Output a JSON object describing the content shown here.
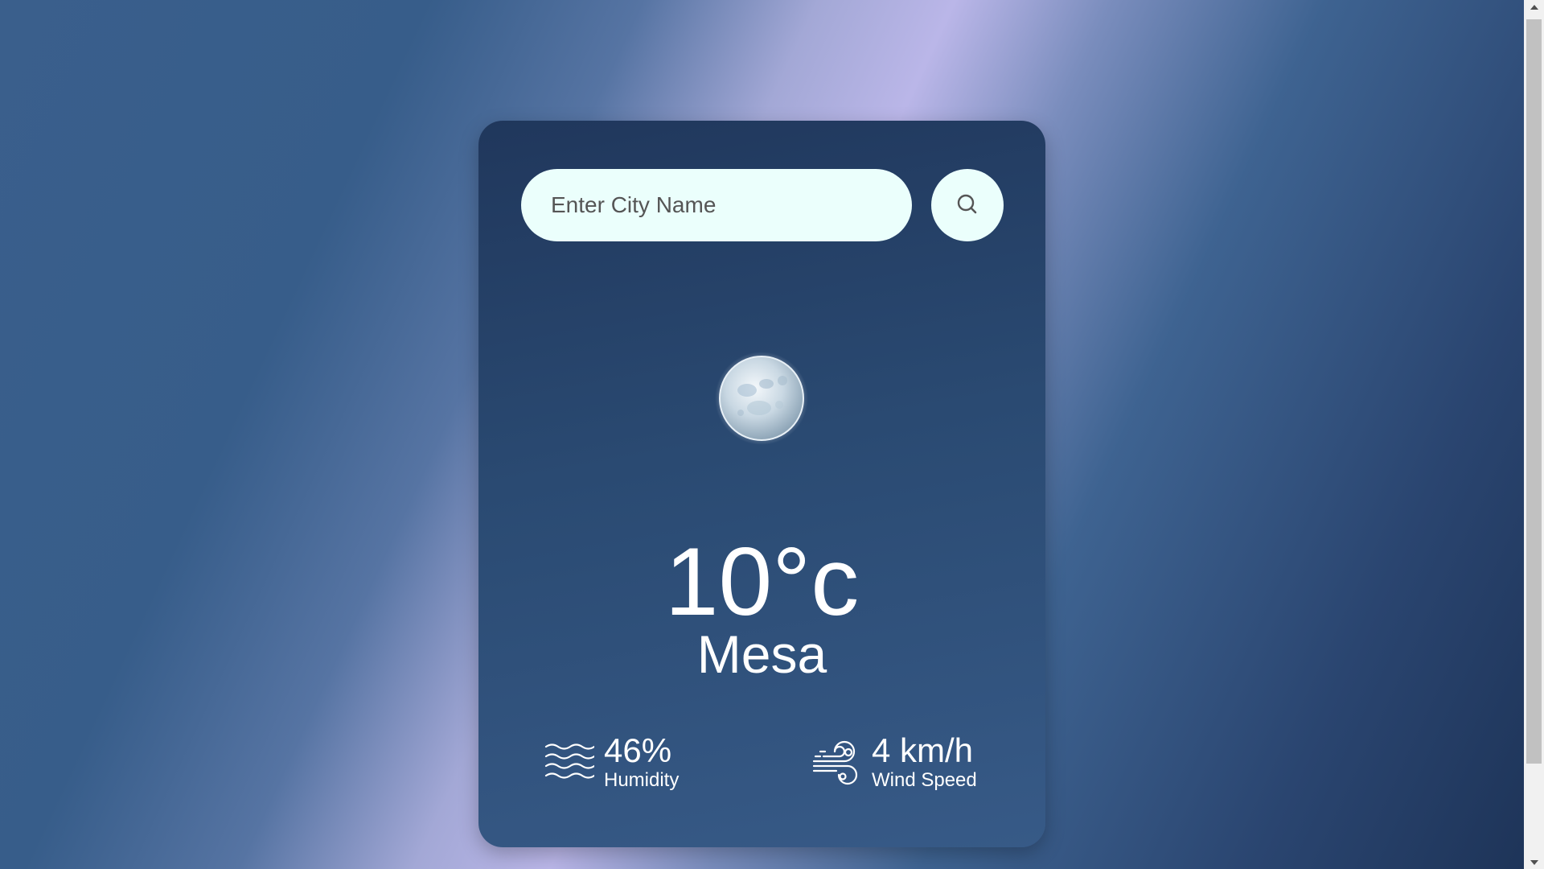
{
  "search": {
    "placeholder": "Enter City Name",
    "value": ""
  },
  "weather": {
    "icon": "moon-icon",
    "temperature": "10°c",
    "city": "Mesa",
    "humidity_value": "46%",
    "humidity_label": "Humidity",
    "wind_value": "4 km/h",
    "wind_label": "Wind Speed"
  },
  "colors": {
    "card_top": "#20375c",
    "card_bottom": "#375a87",
    "input_bg": "#ebfffc",
    "text": "#ffffff"
  }
}
